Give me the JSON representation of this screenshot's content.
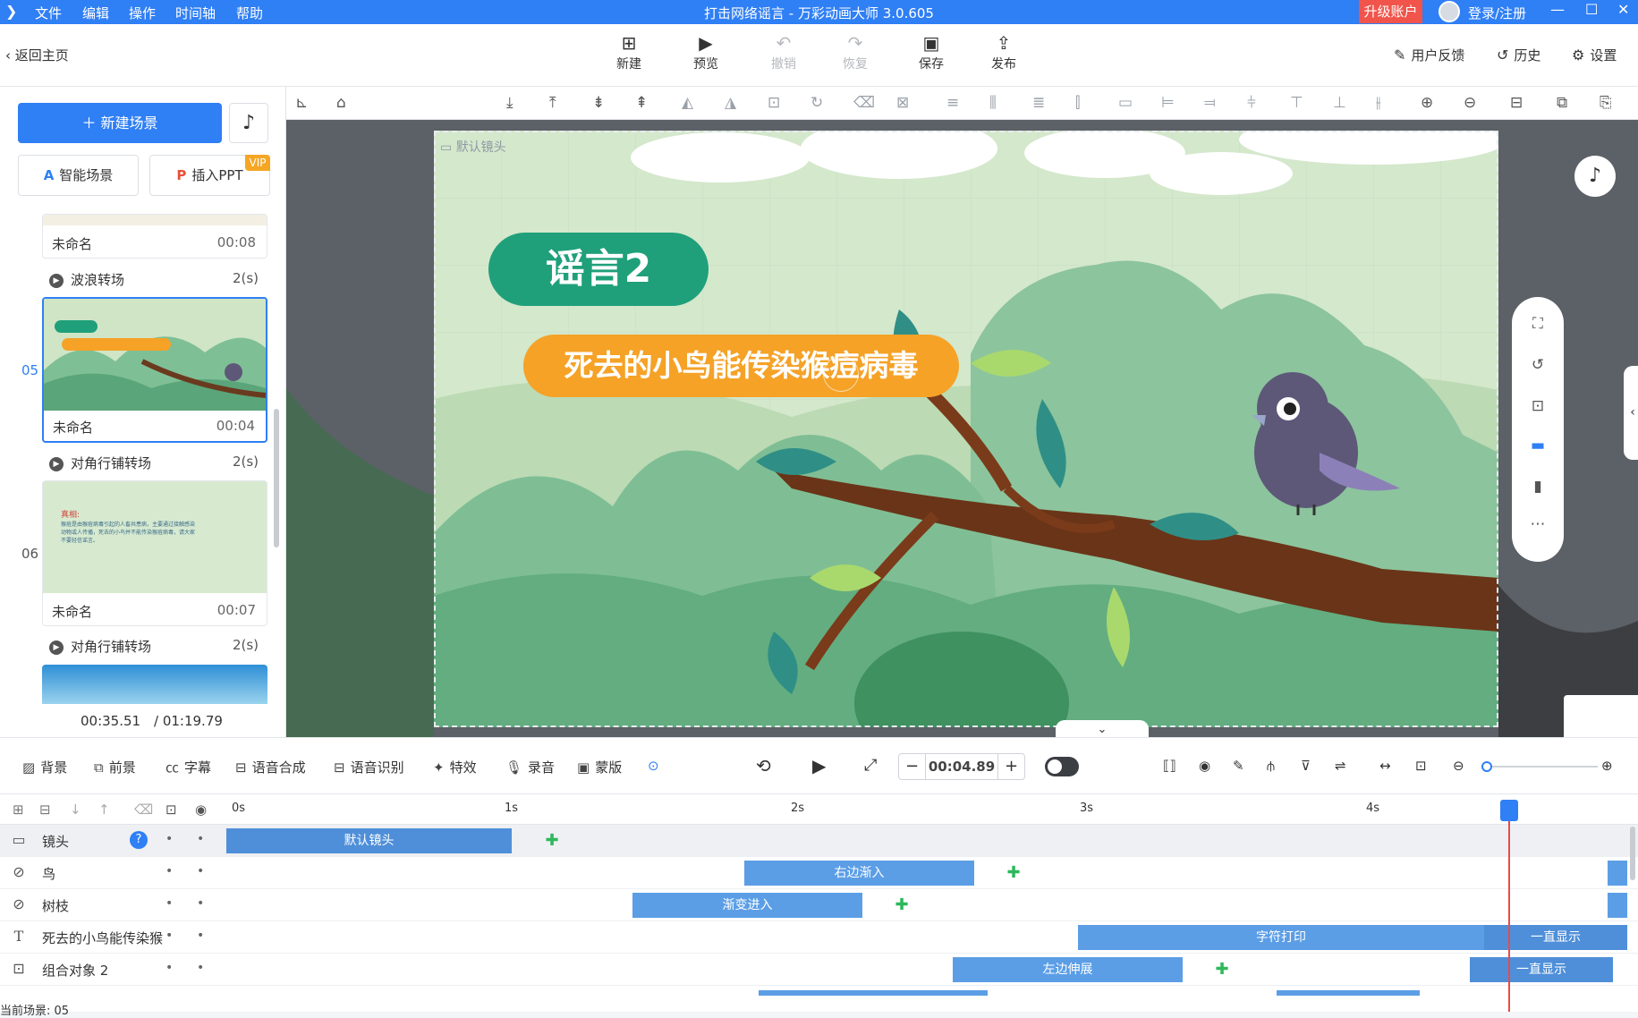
{
  "app": {
    "title": "打击网络谣言 - 万彩动画大师 3.0.605",
    "menu": [
      "文件",
      "编辑",
      "操作",
      "时间轴",
      "帮助"
    ],
    "upgrade": "升级账户",
    "login": "登录/注册"
  },
  "toolbar": {
    "back": "返回主页",
    "new": "新建",
    "preview": "预览",
    "undo": "撤销",
    "redo": "恢复",
    "save": "保存",
    "publish": "发布",
    "feedback": "用户反馈",
    "history": "历史",
    "settings": "设置"
  },
  "left": {
    "new_scene": "新建场景",
    "smart_scene": "智能场景",
    "insert_ppt": "插入PPT",
    "vip": "VIP",
    "scenes": [
      {
        "num": "",
        "name": "未命名",
        "dur": "00:08"
      },
      {
        "num": "05",
        "name": "未命名",
        "dur": "00:04"
      },
      {
        "num": "06",
        "name": "未命名",
        "dur": "00:07"
      }
    ],
    "transitions": [
      {
        "name": "波浪转场",
        "dur": "2(s)"
      },
      {
        "name": "对角行铺转场",
        "dur": "2(s)"
      },
      {
        "name": "对角行铺转场",
        "dur": "2(s)"
      }
    ],
    "thumb05": {
      "title": "谣言2",
      "subtitle": "死去的小鸟能传染猴痘病毒"
    },
    "thumb06": {
      "title": "真相:",
      "body": "猴痘是由猴痘病毒引起的人畜共患病，主要通过接触感染动物或人传播，死去的小鸟并不能传染猴痘病毒，请大家不要轻信谣言。"
    },
    "time_current": "00:35.51",
    "time_total": "/ 01:19.79"
  },
  "canvas": {
    "camera_label": "默认镜头",
    "title": "谣言2",
    "subtitle": "死去的小鸟能传染猴痘病毒"
  },
  "timeline_tools": {
    "bg": "背景",
    "fg": "前景",
    "subtitle": "字幕",
    "tts": "语音合成",
    "asr": "语音识别",
    "fx": "特效",
    "record": "录音",
    "mask": "蒙版",
    "time": "00:04.89"
  },
  "ruler": [
    "0s",
    "1s",
    "2s",
    "3s",
    "4s"
  ],
  "tracks": [
    {
      "name": "镜头",
      "clips": [
        {
          "label": "默认镜头"
        }
      ]
    },
    {
      "name": "鸟",
      "clips": [
        {
          "label": "右边渐入"
        }
      ]
    },
    {
      "name": "树枝",
      "clips": [
        {
          "label": "渐变进入"
        }
      ]
    },
    {
      "name": "死去的小鸟能传染猴",
      "clips": [
        {
          "label": "字符打印"
        },
        {
          "label": "一直显示"
        }
      ]
    },
    {
      "name": "组合对象 2",
      "clips": [
        {
          "label": "左边伸展"
        },
        {
          "label": "一直显示"
        }
      ]
    }
  ],
  "current_scene": "当前场景: 05",
  "colors": {
    "accent": "#2f7ff5",
    "title_green": "#1fa07a",
    "subtitle_orange": "#f5a227",
    "clip_blue": "#5b9ee6",
    "playhead": "#e84a4a",
    "keyframe": "#2eb85c"
  }
}
